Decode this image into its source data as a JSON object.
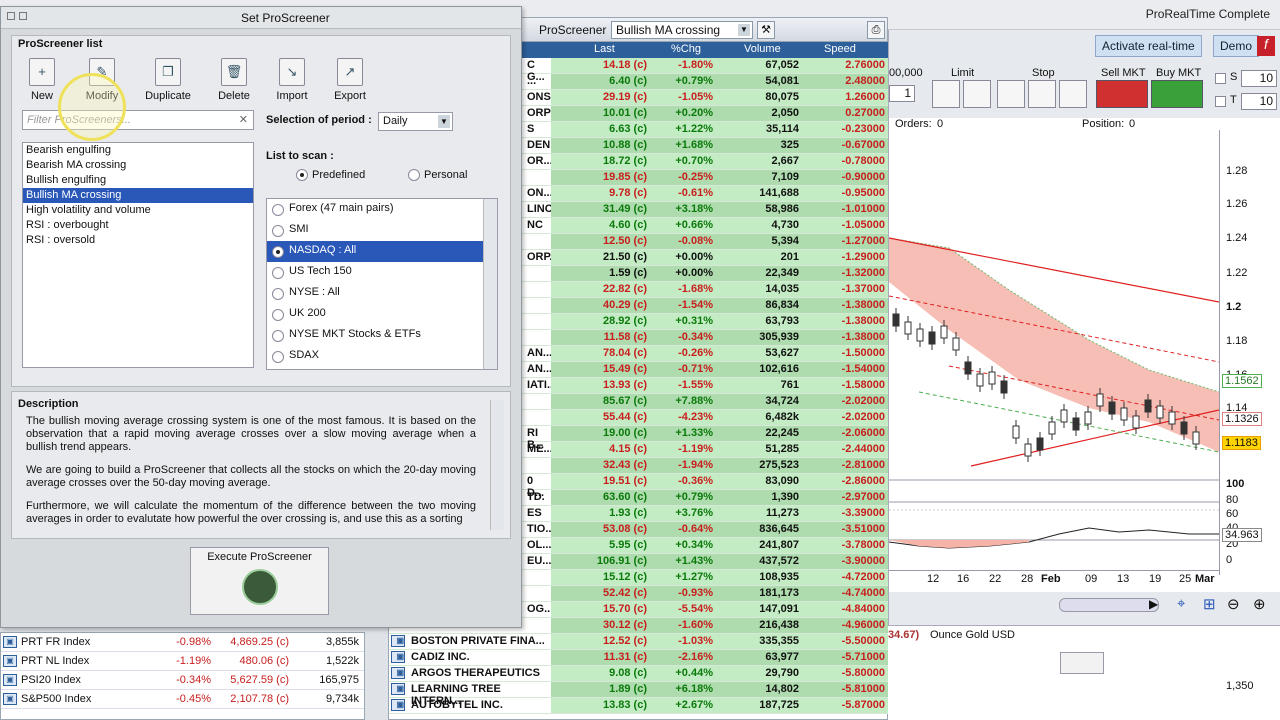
{
  "app": {
    "title": "ProRealTime Complete"
  },
  "screener_window": {
    "title": "Set ProScreener",
    "list_section": "ProScreener list",
    "toolbar": [
      {
        "label": "New",
        "icon": "new-doc-icon"
      },
      {
        "label": "Modify",
        "icon": "pencil-icon"
      },
      {
        "label": "Duplicate",
        "icon": "duplicate-icon"
      },
      {
        "label": "Delete",
        "icon": "trash-icon"
      },
      {
        "label": "Import",
        "icon": "import-icon"
      },
      {
        "label": "Export",
        "icon": "export-icon"
      }
    ],
    "filter_placeholder": "Filter ProScreeners...",
    "screeners": [
      "Bearish engulfing",
      "Bearish MA crossing",
      "Bullish engulfing",
      "Bullish MA crossing",
      "High volatility and volume",
      "RSI : overbought",
      "RSI : oversold"
    ],
    "selected_screener": 3,
    "period_label": "Selection of period :",
    "period_value": "Daily",
    "scan_label": "List to scan :",
    "predefined": "Predefined",
    "personal": "Personal",
    "scan_lists": [
      "Forex (47 main pairs)",
      "SMI",
      "NASDAQ : All",
      "US Tech 150",
      "NYSE : All",
      "UK 200",
      "NYSE MKT Stocks & ETFs",
      "SDAX"
    ],
    "selected_scan": 2,
    "description_title": "Description",
    "description": [
      "The bullish moving average crossing system is one of the most famous. It is based on the observation that a rapid moving average crosses over a slow moving average when a bullish trend appears.",
      "We are going to build a ProScreener that collects all the stocks on which the 20-day moving average crosses over the 50-day moving average.",
      "Furthermore, we will calculate the momentum of the difference between the two moving averages in order to evalutate how powerful the over crossing is, and use this as a sorting"
    ],
    "execute_label": "Execute ProScreener"
  },
  "results": {
    "title": "ProScreener",
    "screener": "Bullish MA crossing",
    "columns": [
      "Last",
      "%Chg",
      "Volume",
      "Speed"
    ],
    "rows": [
      {
        "name": "C G...",
        "last": "14.18 (c)",
        "chg": "-1.80%",
        "vol": "67,052",
        "speed": "2.76000"
      },
      {
        "name": "...",
        "last": "6.40 (c)",
        "chg": "+0.79%",
        "vol": "54,081",
        "speed": "2.48000"
      },
      {
        "name": "ONS",
        "last": "29.19 (c)",
        "chg": "-1.05%",
        "vol": "80,075",
        "speed": "1.26000"
      },
      {
        "name": "ORP",
        "last": "10.01 (c)",
        "chg": "+0.20%",
        "vol": "2,050",
        "speed": "0.27000"
      },
      {
        "name": "S",
        "last": "6.63 (c)",
        "chg": "+1.22%",
        "vol": "35,114",
        "speed": "-0.23000"
      },
      {
        "name": "DEN...",
        "last": "10.88 (c)",
        "chg": "+1.68%",
        "vol": "325",
        "speed": "-0.67000"
      },
      {
        "name": "OR...",
        "last": "18.72 (c)",
        "chg": "+0.70%",
        "vol": "2,667",
        "speed": "-0.78000"
      },
      {
        "name": "",
        "last": "19.85 (c)",
        "chg": "-0.25%",
        "vol": "7,109",
        "speed": "-0.90000"
      },
      {
        "name": "ON...",
        "last": "9.78 (c)",
        "chg": "-0.61%",
        "vol": "141,688",
        "speed": "-0.95000"
      },
      {
        "name": "LINC.",
        "last": "31.49 (c)",
        "chg": "+3.18%",
        "vol": "58,986",
        "speed": "-1.01000"
      },
      {
        "name": "NC",
        "last": "4.60 (c)",
        "chg": "+0.66%",
        "vol": "4,730",
        "speed": "-1.05000"
      },
      {
        "name": "",
        "last": "12.50 (c)",
        "chg": "-0.08%",
        "vol": "5,394",
        "speed": "-1.27000"
      },
      {
        "name": "ORP.",
        "last": "21.50 (c)",
        "chg": "+0.00%",
        "vol": "201",
        "speed": "-1.29000"
      },
      {
        "name": "",
        "last": "1.59 (c)",
        "chg": "+0.00%",
        "vol": "22,349",
        "speed": "-1.32000"
      },
      {
        "name": "",
        "last": "22.82 (c)",
        "chg": "-1.68%",
        "vol": "14,035",
        "speed": "-1.37000"
      },
      {
        "name": "",
        "last": "40.29 (c)",
        "chg": "-1.54%",
        "vol": "86,834",
        "speed": "-1.38000"
      },
      {
        "name": "",
        "last": "28.92 (c)",
        "chg": "+0.31%",
        "vol": "63,793",
        "speed": "-1.38000"
      },
      {
        "name": "",
        "last": "11.58 (c)",
        "chg": "-0.34%",
        "vol": "305,939",
        "speed": "-1.38000"
      },
      {
        "name": "AN...",
        "last": "78.04 (c)",
        "chg": "-0.26%",
        "vol": "53,627",
        "speed": "-1.50000"
      },
      {
        "name": "AN...",
        "last": "15.49 (c)",
        "chg": "-0.71%",
        "vol": "102,616",
        "speed": "-1.54000"
      },
      {
        "name": "IATI...",
        "last": "13.93 (c)",
        "chg": "-1.55%",
        "vol": "761",
        "speed": "-1.58000"
      },
      {
        "name": "",
        "last": "85.67 (c)",
        "chg": "+7.88%",
        "vol": "34,724",
        "speed": "-2.02000"
      },
      {
        "name": "",
        "last": "55.44 (c)",
        "chg": "-4.23%",
        "vol": "6,482k",
        "speed": "-2.02000"
      },
      {
        "name": "RI B...",
        "last": "19.00 (c)",
        "chg": "+1.33%",
        "vol": "22,245",
        "speed": "-2.06000"
      },
      {
        "name": "ME...",
        "last": "4.15 (c)",
        "chg": "-1.19%",
        "vol": "51,285",
        "speed": "-2.44000"
      },
      {
        "name": "",
        "last": "32.43 (c)",
        "chg": "-1.94%",
        "vol": "275,523",
        "speed": "-2.81000"
      },
      {
        "name": "0 D...",
        "last": "19.51 (c)",
        "chg": "-0.36%",
        "vol": "83,090",
        "speed": "-2.86000"
      },
      {
        "name": "TD.",
        "last": "63.60 (c)",
        "chg": "+0.79%",
        "vol": "1,390",
        "speed": "-2.97000"
      },
      {
        "name": "ES",
        "last": "1.93 (c)",
        "chg": "+3.76%",
        "vol": "11,273",
        "speed": "-3.39000"
      },
      {
        "name": "TIO...",
        "last": "53.08 (c)",
        "chg": "-0.64%",
        "vol": "836,645",
        "speed": "-3.51000"
      },
      {
        "name": "OL...",
        "last": "5.95 (c)",
        "chg": "+0.34%",
        "vol": "241,807",
        "speed": "-3.78000"
      },
      {
        "name": "EU...",
        "last": "106.91 (c)",
        "chg": "+1.43%",
        "vol": "437,572",
        "speed": "-3.90000"
      },
      {
        "name": "",
        "last": "15.12 (c)",
        "chg": "+1.27%",
        "vol": "108,935",
        "speed": "-4.72000"
      },
      {
        "name": "",
        "last": "52.42 (c)",
        "chg": "-0.93%",
        "vol": "181,173",
        "speed": "-4.74000"
      },
      {
        "name": "OG...",
        "last": "15.70 (c)",
        "chg": "-5.54%",
        "vol": "147,091",
        "speed": "-4.84000"
      },
      {
        "name": "",
        "last": "30.12 (c)",
        "chg": "-1.60%",
        "vol": "216,438",
        "speed": "-4.96000"
      },
      {
        "name": "BOSTON PRIVATE FINA...",
        "last": "12.52 (c)",
        "chg": "-1.03%",
        "vol": "335,355",
        "speed": "-5.50000"
      },
      {
        "name": "CADIZ INC.",
        "last": "11.31 (c)",
        "chg": "-2.16%",
        "vol": "63,977",
        "speed": "-5.71000"
      },
      {
        "name": "ARGOS THERAPEUTICS",
        "last": "9.08 (c)",
        "chg": "+0.44%",
        "vol": "29,790",
        "speed": "-5.80000"
      },
      {
        "name": "LEARNING TREE INTERN...",
        "last": "1.89 (c)",
        "chg": "+6.18%",
        "vol": "14,802",
        "speed": "-5.81000"
      },
      {
        "name": "AUTOBYTEL INC.",
        "last": "13.83 (c)",
        "chg": "+2.67%",
        "vol": "187,725",
        "speed": "-5.87000"
      }
    ]
  },
  "trade": {
    "activate": "Activate real-time",
    "demo": "Demo",
    "qty": "00,000",
    "qty2": "1",
    "limit": "Limit",
    "stop": "Stop",
    "sell": "Sell MKT",
    "buy": "Buy MKT",
    "s_label": "S",
    "t_label": "T",
    "s_val": "10",
    "t_val": "10",
    "orders": "Orders:",
    "orders_val": "0",
    "position": "Position:",
    "position_val": "0"
  },
  "chart": {
    "y_labels": [
      "1.28",
      "1.26",
      "1.24",
      "1.22",
      "1.2",
      "1.18",
      "1.16",
      "1.14",
      "1.12"
    ],
    "price_tags": [
      "1.1562",
      "1.1326",
      "1.1183"
    ],
    "ind_labels": [
      "100",
      "80",
      "60",
      "40",
      "20",
      "0"
    ],
    "ind_value": "34.963",
    "x_labels": [
      "12",
      "16",
      "22",
      "28",
      "Feb",
      "09",
      "13",
      "19",
      "25",
      "Mar"
    ]
  },
  "lower_chart": {
    "label": "Ounce Gold USD",
    "value": "34.67)",
    "y": "1,350"
  },
  "index_list": [
    {
      "name": "PRT FR Index",
      "chg": "-0.98%",
      "last": "4,869.25 (c)",
      "vol": "3,855k"
    },
    {
      "name": "PRT NL Index",
      "chg": "-1.19%",
      "last": "480.06 (c)",
      "vol": "1,522k"
    },
    {
      "name": "PSI20 Index",
      "chg": "-0.34%",
      "last": "5,627.59 (c)",
      "vol": "165,975"
    },
    {
      "name": "S&P500 Index",
      "chg": "-0.45%",
      "last": "2,107.78 (c)",
      "vol": "9,734k"
    }
  ],
  "colors": {
    "accent": "#2d5f9a",
    "selection": "#2a58b8",
    "neg": "#c81e1e",
    "pos": "#0a7a0a",
    "row_bg": "#c4ecc4"
  }
}
